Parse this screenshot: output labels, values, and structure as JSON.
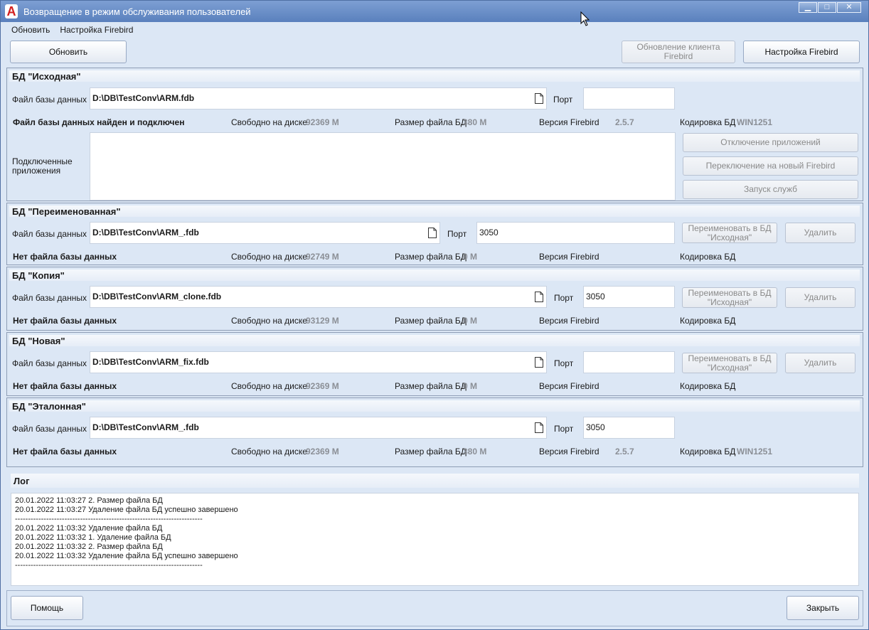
{
  "window": {
    "title": "Возвращение в режим обслуживания пользователей",
    "app_icon_glyph": "A"
  },
  "menu": {
    "items": [
      "Обновить",
      "Настройка Firebird"
    ]
  },
  "toolbar": {
    "refresh_label": "Обновить",
    "update_client_label": "Обновление клиента Firebird",
    "firebird_settings_label": "Настройка Firebird"
  },
  "labels": {
    "db_file": "Файл базы данных",
    "port": "Порт",
    "free_disk": "Свободно на диске",
    "file_size": "Размер файла  БД",
    "fb_version": "Версия Firebird",
    "encoding": "Кодировка БД",
    "connected_apps": "Подключенные приложения",
    "rename_to_source": "Переименовать в БД \"Исходная\"",
    "delete": "Удалить",
    "disconnect_apps": "Отключение приложений",
    "switch_fb": "Переключение на новый Firebird",
    "start_services": "Запуск служб"
  },
  "databases": [
    {
      "title": "БД \"Исходная\"",
      "path": "D:\\DB\\TestConv\\ARM.fdb",
      "port": "",
      "status": "Файл базы данных найден и подключен",
      "free_disk": "92369 М",
      "file_size": "380 М",
      "fb_version": "2.5.7",
      "encoding": "WIN1251"
    },
    {
      "title": "БД \"Переименованная\"",
      "path": "D:\\DB\\TestConv\\ARM_.fdb",
      "port": "3050",
      "status": "Нет файла базы данных",
      "free_disk": "92749 М",
      "file_size": "0 М",
      "fb_version": "",
      "encoding": ""
    },
    {
      "title": "БД \"Копия\"",
      "path": "D:\\DB\\TestConv\\ARM_clone.fdb",
      "port": "3050",
      "status": "Нет файла базы данных",
      "free_disk": "93129 М",
      "file_size": "0 М",
      "fb_version": "",
      "encoding": ""
    },
    {
      "title": "БД \"Новая\"",
      "path": "D:\\DB\\TestConv\\ARM_fix.fdb",
      "port": "",
      "status": "Нет файла базы данных",
      "free_disk": "92369 М",
      "file_size": "0 М",
      "fb_version": "",
      "encoding": ""
    },
    {
      "title": "БД \"Эталонная\"",
      "path": "D:\\DB\\TestConv\\ARM_.fdb",
      "port": "3050",
      "status": "Нет файла базы данных",
      "free_disk": "92369 М",
      "file_size": "380 М",
      "fb_version": "2.5.7",
      "encoding": "WIN1251"
    }
  ],
  "log": {
    "title": "Лог",
    "lines": [
      "20.01.2022 11:03:27 2. Размер файла БД",
      "20.01.2022 11:03:27 Удаление файла БД успешно завершено",
      "------------------------------------------------------------------------",
      "20.01.2022 11:03:32 Удаление файла БД",
      "20.01.2022 11:03:32 1. Удаление файла БД",
      "20.01.2022 11:03:32 2. Размер файла БД",
      "20.01.2022 11:03:32 Удаление файла БД успешно завершено",
      "------------------------------------------------------------------------"
    ]
  },
  "footer": {
    "help_label": "Помощь",
    "close_label": "Закрыть"
  }
}
